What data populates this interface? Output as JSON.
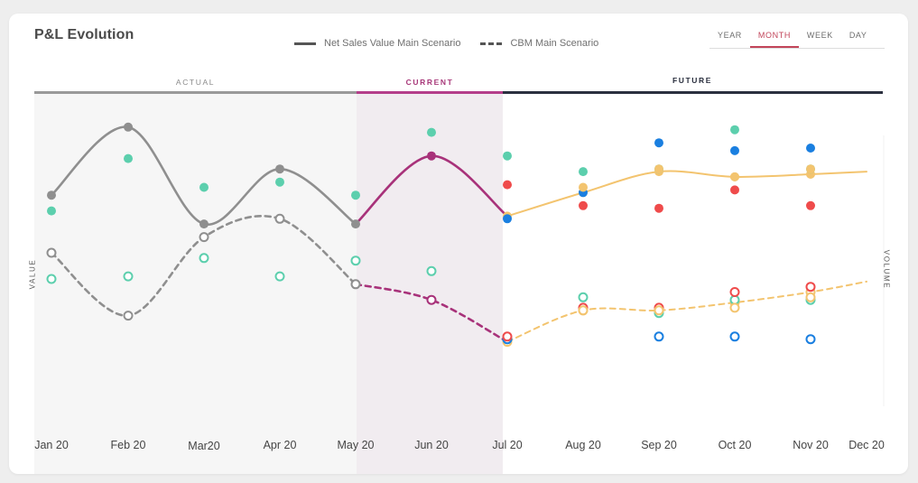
{
  "header": {
    "title": "P&L Evolution",
    "legend": [
      {
        "label": "Net Sales Value Main Scenario",
        "style": "solid"
      },
      {
        "label": "CBM Main Scenario",
        "style": "dashed"
      }
    ],
    "tabs": [
      {
        "label": "YEAR",
        "active": false
      },
      {
        "label": "MONTH",
        "active": true
      },
      {
        "label": "WEEK",
        "active": false
      },
      {
        "label": "DAY",
        "active": false
      }
    ]
  },
  "bands": {
    "actual": "ACTUAL",
    "current": "CURRENT",
    "future": "FUTURE"
  },
  "axes": {
    "left_title": "VALUE",
    "right_title": "VOLUME"
  },
  "colors": {
    "actual_line": "#8f8f8f",
    "current_line": "#a8327a",
    "future_line": "#f3c46f",
    "teal": "#5ccfad",
    "blue": "#1a7fe0",
    "red": "#ef4b4b",
    "orange": "#f3c46f",
    "actual_bg": "#f6f6f6",
    "current_bg": "#f1ecf0"
  },
  "chart_data": {
    "type": "line",
    "x": [
      "Jan 20",
      "Feb 20",
      "Mar20",
      "Apr 20",
      "May 20",
      "Jun 20",
      "Jul 20",
      "Aug 20",
      "Sep 20",
      "Oct 20",
      "Nov 20",
      "Dec 20"
    ],
    "periods": {
      "actual": [
        "Jan 20",
        "May 20"
      ],
      "current": [
        "May 20",
        "Jul 20"
      ],
      "future": [
        "Jul 20",
        "Dec 20"
      ]
    },
    "ylim": [
      0,
      100
    ],
    "series": [
      {
        "name": "Net Sales Value Main Scenario",
        "style": "solid",
        "values": [
          72,
          98,
          61,
          82,
          61,
          87,
          64,
          73,
          81,
          79,
          80,
          81
        ]
      },
      {
        "name": "CBM Main Scenario",
        "style": "dashed",
        "values": [
          50,
          26,
          56,
          63,
          38,
          32,
          16,
          28,
          28,
          31,
          35,
          39
        ]
      }
    ],
    "markers": [
      {
        "color": "teal",
        "filled": true,
        "points": [
          [
            0,
            66
          ],
          [
            1,
            86
          ],
          [
            2,
            75
          ],
          [
            3,
            77
          ],
          [
            4,
            72
          ],
          [
            5,
            96
          ],
          [
            6,
            87
          ],
          [
            7,
            81
          ],
          [
            8,
            82
          ],
          [
            9,
            97
          ],
          [
            10,
            82
          ]
        ]
      },
      {
        "color": "teal",
        "filled": false,
        "points": [
          [
            0,
            40
          ],
          [
            1,
            41
          ],
          [
            2,
            48
          ],
          [
            3,
            41
          ],
          [
            4,
            47
          ],
          [
            5,
            43
          ],
          [
            6,
            17
          ],
          [
            7,
            33
          ],
          [
            8,
            27
          ],
          [
            9,
            32
          ],
          [
            10,
            32
          ]
        ]
      },
      {
        "color": "blue",
        "filled": true,
        "points": [
          [
            6,
            63
          ],
          [
            7,
            73
          ],
          [
            8,
            92
          ],
          [
            9,
            89
          ],
          [
            10,
            90
          ]
        ]
      },
      {
        "color": "blue",
        "filled": false,
        "points": [
          [
            6,
            17
          ],
          [
            8,
            18
          ],
          [
            9,
            18
          ],
          [
            10,
            17
          ]
        ]
      },
      {
        "color": "red",
        "filled": true,
        "points": [
          [
            6,
            76
          ],
          [
            7,
            68
          ],
          [
            8,
            67
          ],
          [
            9,
            74
          ],
          [
            10,
            68
          ]
        ]
      },
      {
        "color": "red",
        "filled": false,
        "points": [
          [
            6,
            18
          ],
          [
            7,
            29
          ],
          [
            8,
            29
          ],
          [
            9,
            35
          ],
          [
            10,
            37
          ]
        ]
      },
      {
        "color": "orange",
        "filled": true,
        "points": [
          [
            7,
            75
          ],
          [
            8,
            82
          ],
          [
            9,
            79
          ],
          [
            10,
            82
          ]
        ]
      },
      {
        "color": "orange",
        "filled": false,
        "points": [
          [
            7,
            28
          ],
          [
            8,
            28
          ],
          [
            9,
            29
          ],
          [
            10,
            33
          ]
        ]
      }
    ]
  }
}
